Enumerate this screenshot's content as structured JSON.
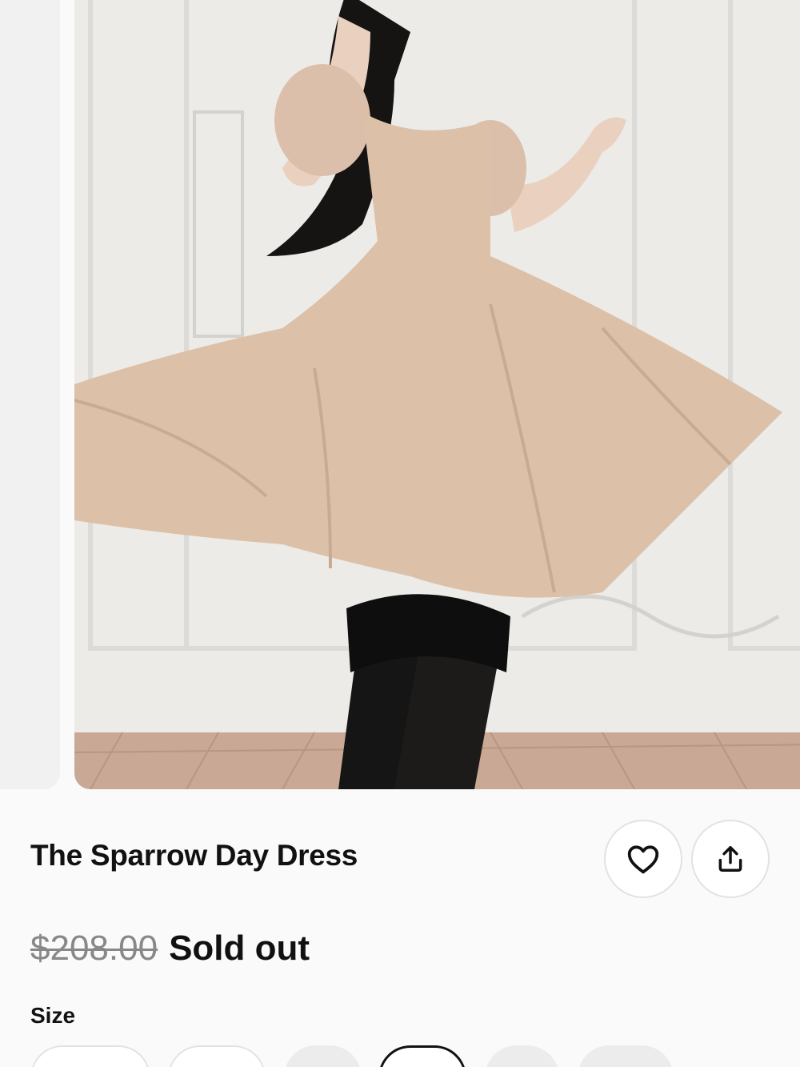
{
  "product": {
    "title": "The Sparrow Day Dress",
    "original_price": "$208.00",
    "status": "Sold out"
  },
  "actions": {
    "favorite_icon": "heart-icon",
    "share_icon": "share-icon"
  },
  "size": {
    "label": "Size"
  },
  "colors": {
    "dress": "#dcc0a8",
    "wall": "#ecebe8",
    "floor": "#c9a896",
    "text": "#111111",
    "muted": "#888888"
  }
}
